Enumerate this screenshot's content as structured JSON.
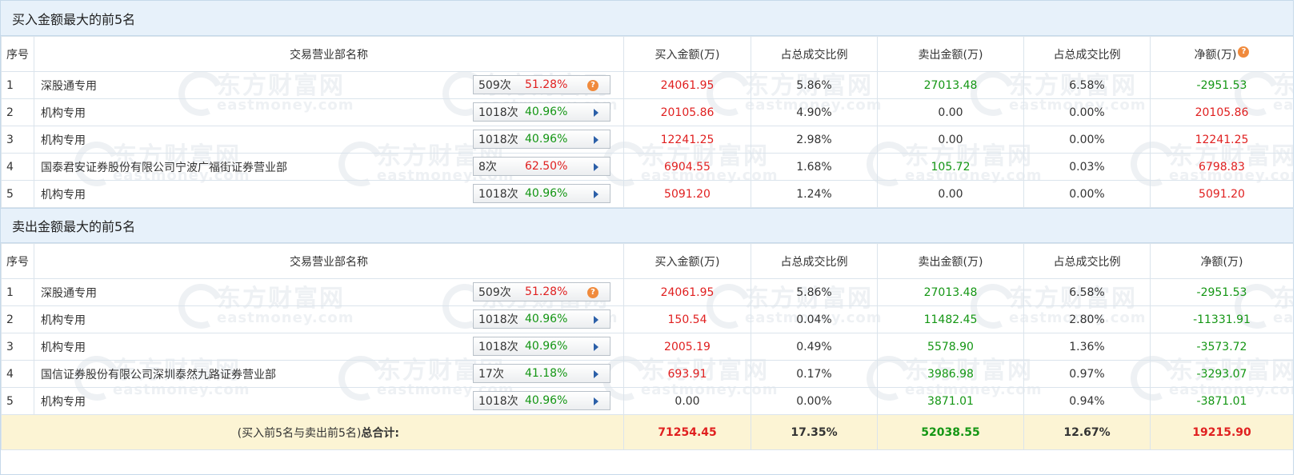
{
  "watermark": {
    "brand": "东方财富网",
    "domain": "eastmoney.com"
  },
  "columns": [
    "序号",
    "交易营业部名称",
    "买入金额(万)",
    "占总成交比例",
    "卖出金额(万)",
    "占总成交比例",
    "净额(万)"
  ],
  "buy_section": {
    "title": "买入金额最大的前5名",
    "rows": [
      {
        "idx": "1",
        "name": "深股通专用",
        "count": "509次",
        "pct": "51.28%",
        "pct_color": "red",
        "icon": "question-icon",
        "buy": "24061.95",
        "buy_ratio": "5.86%",
        "sell": "27013.48",
        "sell_ratio": "6.58%",
        "net": "-2951.53",
        "net_color": "green"
      },
      {
        "idx": "2",
        "name": "机构专用",
        "count": "1018次",
        "pct": "40.96%",
        "pct_color": "green",
        "icon": "arrow-right-icon",
        "buy": "20105.86",
        "buy_ratio": "4.90%",
        "sell": "0.00",
        "sell_ratio": "0.00%",
        "net": "20105.86",
        "net_color": "red"
      },
      {
        "idx": "3",
        "name": "机构专用",
        "count": "1018次",
        "pct": "40.96%",
        "pct_color": "green",
        "icon": "arrow-right-icon",
        "buy": "12241.25",
        "buy_ratio": "2.98%",
        "sell": "0.00",
        "sell_ratio": "0.00%",
        "net": "12241.25",
        "net_color": "red"
      },
      {
        "idx": "4",
        "name": "国泰君安证券股份有限公司宁波广福街证券营业部",
        "count": "8次",
        "pct": "62.50%",
        "pct_color": "red",
        "icon": "arrow-right-icon",
        "buy": "6904.55",
        "buy_ratio": "1.68%",
        "sell": "105.72",
        "sell_ratio": "0.03%",
        "net": "6798.83",
        "net_color": "red"
      },
      {
        "idx": "5",
        "name": "机构专用",
        "count": "1018次",
        "pct": "40.96%",
        "pct_color": "green",
        "icon": "arrow-right-icon",
        "buy": "5091.20",
        "buy_ratio": "1.24%",
        "sell": "0.00",
        "sell_ratio": "0.00%",
        "net": "5091.20",
        "net_color": "red"
      }
    ]
  },
  "sell_section": {
    "title": "卖出金额最大的前5名",
    "rows": [
      {
        "idx": "1",
        "name": "深股通专用",
        "count": "509次",
        "pct": "51.28%",
        "pct_color": "red",
        "icon": "question-icon",
        "buy": "24061.95",
        "buy_ratio": "5.86%",
        "sell": "27013.48",
        "sell_ratio": "6.58%",
        "net": "-2951.53",
        "net_color": "green"
      },
      {
        "idx": "2",
        "name": "机构专用",
        "count": "1018次",
        "pct": "40.96%",
        "pct_color": "green",
        "icon": "arrow-right-icon",
        "buy": "150.54",
        "buy_ratio": "0.04%",
        "sell": "11482.45",
        "sell_ratio": "2.80%",
        "net": "-11331.91",
        "net_color": "green"
      },
      {
        "idx": "3",
        "name": "机构专用",
        "count": "1018次",
        "pct": "40.96%",
        "pct_color": "green",
        "icon": "arrow-right-icon",
        "buy": "2005.19",
        "buy_ratio": "0.49%",
        "sell": "5578.90",
        "sell_ratio": "1.36%",
        "net": "-3573.72",
        "net_color": "green"
      },
      {
        "idx": "4",
        "name": "国信证券股份有限公司深圳泰然九路证券营业部",
        "count": "17次",
        "pct": "41.18%",
        "pct_color": "green",
        "icon": "arrow-right-icon",
        "buy": "693.91",
        "buy_ratio": "0.17%",
        "sell": "3986.98",
        "sell_ratio": "0.97%",
        "net": "-3293.07",
        "net_color": "green"
      },
      {
        "idx": "5",
        "name": "机构专用",
        "count": "1018次",
        "pct": "40.96%",
        "pct_color": "green",
        "icon": "arrow-right-icon",
        "buy": "0.00",
        "buy_ratio": "0.00%",
        "sell": "3871.01",
        "sell_ratio": "0.94%",
        "net": "-3871.01",
        "net_color": "green"
      }
    ]
  },
  "total": {
    "label_prefix": "(买入前5名与卖出前5名)",
    "label_bold": "总合计:",
    "buy": "71254.45",
    "buy_ratio": "17.35%",
    "sell": "52038.55",
    "sell_ratio": "12.67%",
    "net": "19215.90",
    "net_color": "red"
  },
  "colors": {
    "red": "#e02020",
    "green": "#149614",
    "header_bg": "#e7f1fa",
    "total_bg": "#fcf4d4",
    "icon_orange": "#f08a3c",
    "arrow_blue": "#2b5fa8"
  }
}
